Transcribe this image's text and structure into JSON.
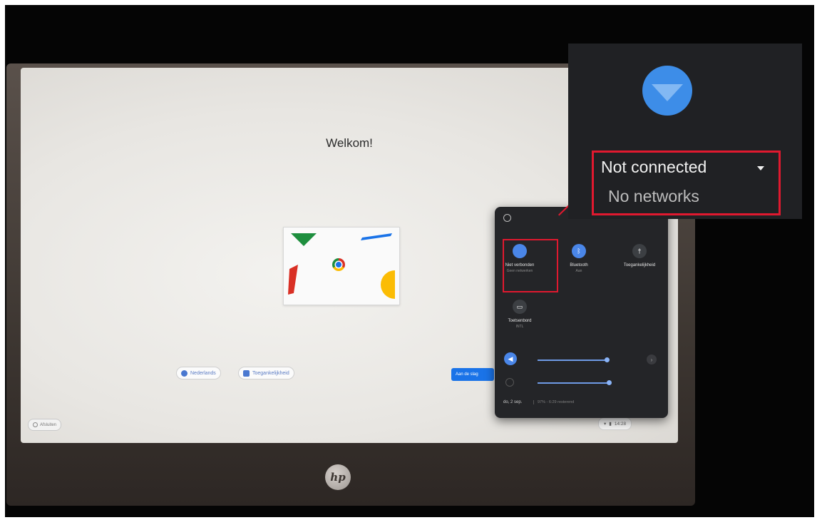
{
  "screen": {
    "welcome_title": "Welkom!",
    "language_button": "Nederlands",
    "accessibility_button": "Toegankelijkheid",
    "next_button": "Aan de slag",
    "shutdown_button": "Afsluiten",
    "clock": "14:28"
  },
  "quick_settings": {
    "tiles": [
      {
        "label": "Niet verbonden",
        "sublabel": "Geen netwerken",
        "icon": "wifi-icon",
        "color": "#4a86e8"
      },
      {
        "label": "Bluetooth",
        "sublabel": "Aan",
        "icon": "bluetooth-icon",
        "color": "#4a86e8"
      },
      {
        "label": "Toegankelijkheid",
        "sublabel": "",
        "icon": "accessibility-icon",
        "color": "#3c3f43"
      },
      {
        "label": "Toetsenbord",
        "sublabel": "INTL",
        "icon": "keyboard-icon",
        "color": "#3c3f43"
      }
    ],
    "volume_level": 0.7,
    "brightness_level": 0.72,
    "date_text": "do, 2 sep.",
    "battery_text": "97% - 6:29 resterend"
  },
  "zoom_callout": {
    "status": "Not connected",
    "substatus": "No networks",
    "icon": "wifi-icon",
    "highlight_color": "#e0192f"
  },
  "device": {
    "brand": "hp"
  }
}
